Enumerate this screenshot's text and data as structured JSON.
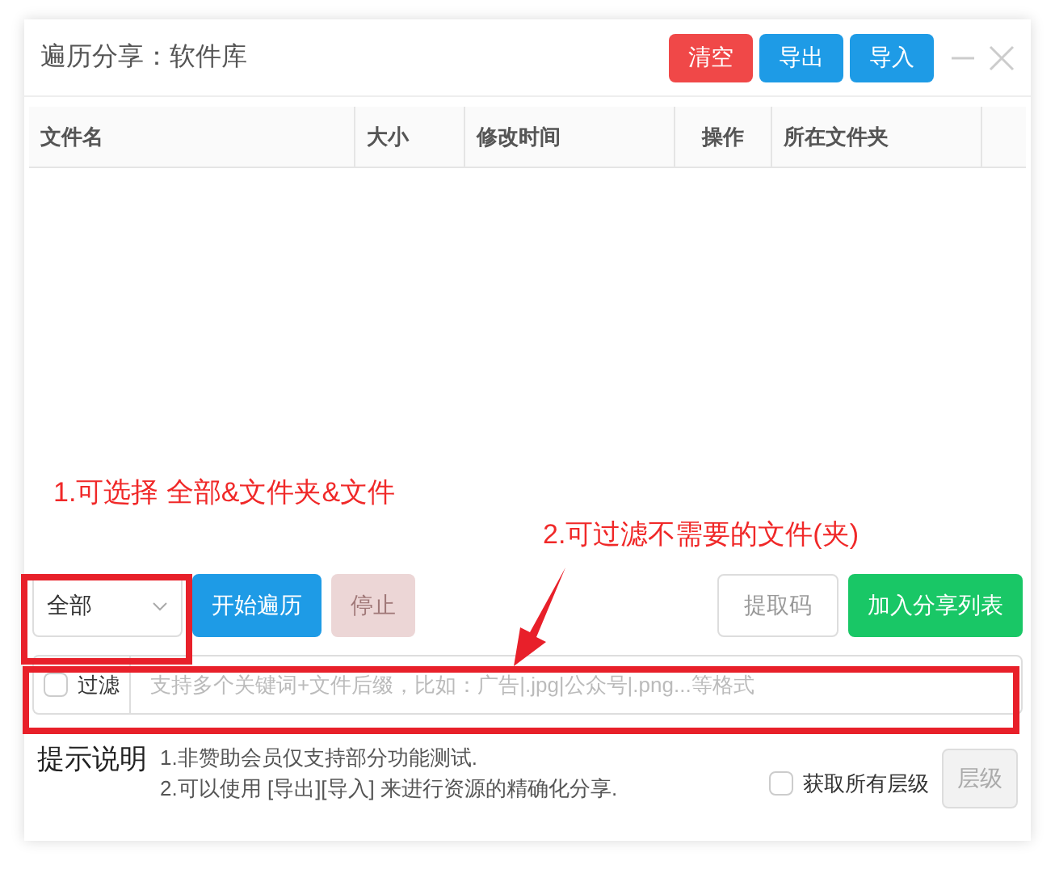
{
  "window": {
    "title": "遍历分享：软件库"
  },
  "header_buttons": [
    {
      "label": "清空",
      "kind": "danger"
    },
    {
      "label": "导出",
      "kind": "primary"
    },
    {
      "label": "导入",
      "kind": "primary"
    }
  ],
  "table": {
    "columns": [
      "文件名",
      "大小",
      "修改时间",
      "操作",
      "所在文件夹"
    ]
  },
  "annotations": [
    "1.可选择 全部&文件夹&文件",
    "2.可过滤不需要的文件(夹)"
  ],
  "scope_select": {
    "value": "全部"
  },
  "actions": [
    {
      "label": "开始遍历",
      "kind": "primary",
      "disabled": false
    },
    {
      "label": "停止",
      "kind": "danger",
      "disabled": true
    }
  ],
  "right_actions": [
    {
      "label": "提取码",
      "kind": "default",
      "disabled": false
    },
    {
      "label": "加入分享列表",
      "kind": "success",
      "disabled": false
    }
  ],
  "filter": {
    "label": "过滤",
    "checked": false,
    "placeholder": "支持多个关键词+文件后缀，比如：广告|.jpg|公众号|.png...等格式"
  },
  "tips": {
    "title": "提示说明",
    "lines": [
      "1.非赞助会员仅支持部分功能测试.",
      "2.可以使用 [导出][导入] 来进行资源的精确化分享."
    ]
  },
  "all_levels": {
    "label": "获取所有层级",
    "checked": false
  },
  "level_button": {
    "label": "层级",
    "disabled": true
  }
}
